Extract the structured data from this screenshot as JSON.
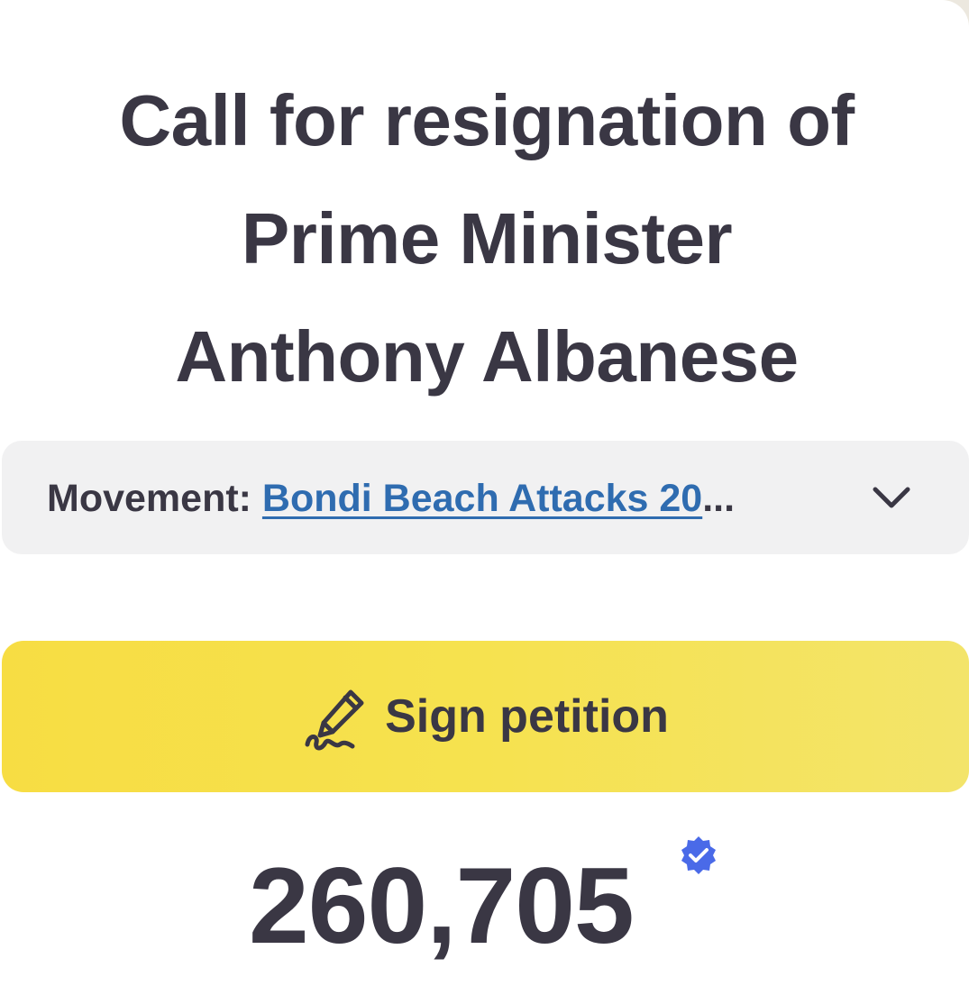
{
  "petition": {
    "title_lines": [
      "Call for resignation of",
      "Prime Minister",
      "Anthony Albanese"
    ]
  },
  "movement": {
    "label": "Movement:",
    "link_text": "Bondi Beach Attacks 20",
    "ellipsis": "...",
    "expand_icon": "chevron-down-icon"
  },
  "sign_button": {
    "label": "Sign petition",
    "icon": "pen-signature-icon"
  },
  "signatures": {
    "count": "260,705",
    "verified_icon": "verified-badge-icon"
  },
  "colors": {
    "text": "#3a3744",
    "link": "#2f6cb0",
    "button": "#f7dd43",
    "verified": "#4a6ae8",
    "movement_bg": "#f1f1f2"
  }
}
